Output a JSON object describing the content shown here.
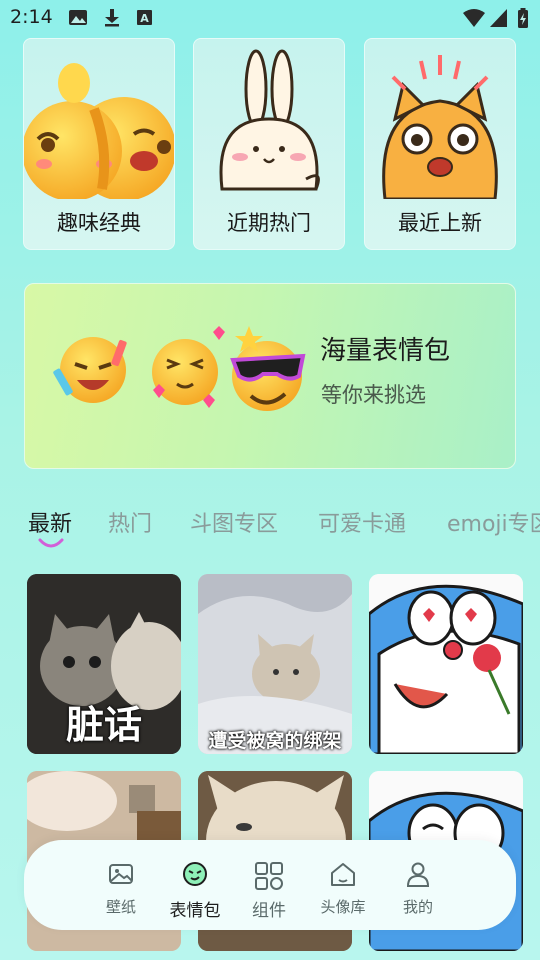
{
  "status_bar": {
    "time": "2:14"
  },
  "categories": [
    {
      "label": "趣味经典"
    },
    {
      "label": "近期热门"
    },
    {
      "label": "最近上新"
    }
  ],
  "banner": {
    "title": "海量表情包",
    "subtitle": "等你来挑选"
  },
  "tabs": [
    "最新",
    "热门",
    "斗图专区",
    "可爱卡通",
    "emoji专区"
  ],
  "active_tab": "最新",
  "grid": [
    {
      "caption": "脏话"
    },
    {
      "caption": "遭受被窝的绑架"
    },
    {
      "caption": ""
    },
    {
      "caption": ""
    },
    {
      "caption": ""
    },
    {
      "caption": ""
    }
  ],
  "nav": [
    {
      "label": "壁纸",
      "icon": "image-icon"
    },
    {
      "label": "表情包",
      "icon": "emoji-icon"
    },
    {
      "label": "组件",
      "icon": "grid-icon"
    },
    {
      "label": "头像库",
      "icon": "home-icon"
    },
    {
      "label": "我的",
      "icon": "person-icon"
    }
  ],
  "colors": {
    "accent": "#d25fd8",
    "background": "#8ef0ea",
    "nav_bg": "#f1fdfc"
  }
}
